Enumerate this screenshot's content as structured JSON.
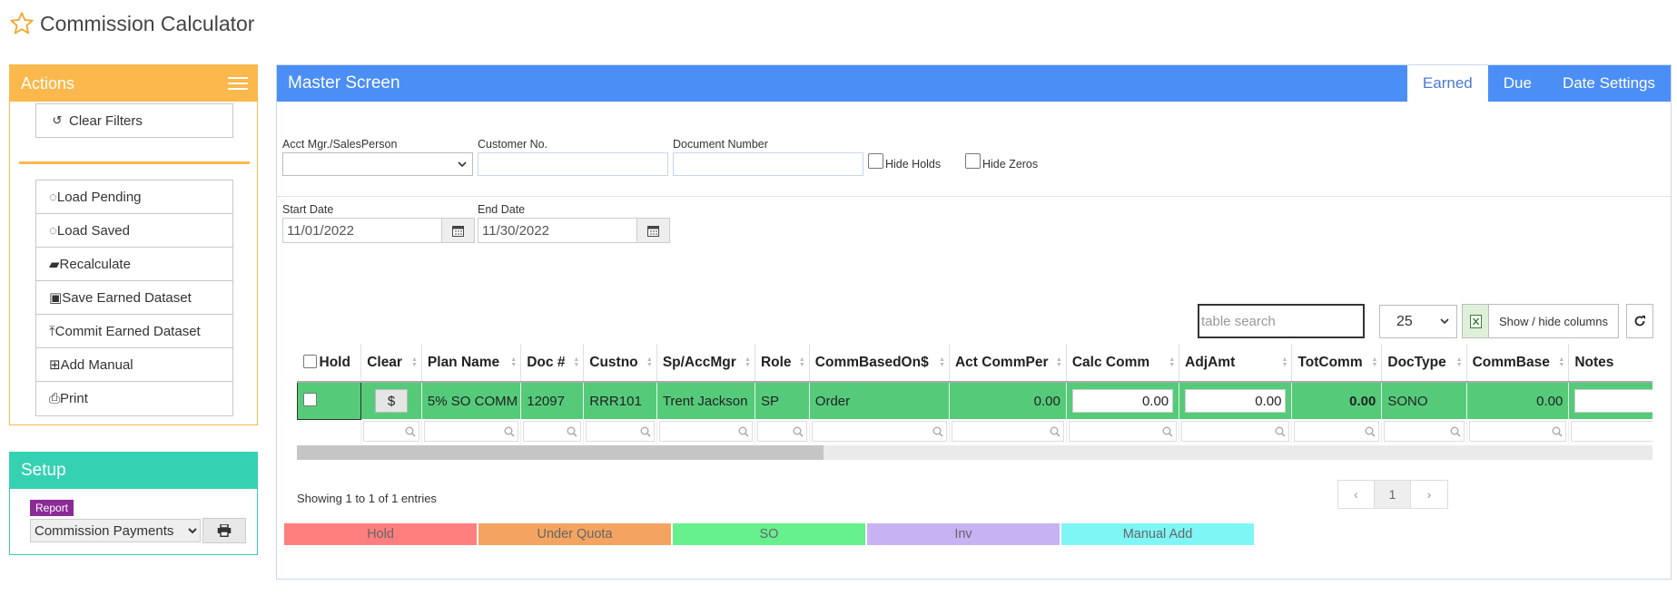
{
  "app": {
    "title": "Commission Calculator"
  },
  "actions": {
    "title": "Actions",
    "clear_filters": "Clear Filters",
    "items": [
      {
        "label": "Load Pending",
        "icon": "spinner-icon"
      },
      {
        "label": "Load Saved",
        "icon": "spinner-icon"
      },
      {
        "label": "Recalculate",
        "icon": "book-icon"
      },
      {
        "label": "Save Earned Dataset",
        "icon": "save-icon"
      },
      {
        "label": "Commit Earned Dataset",
        "icon": "upload-icon"
      },
      {
        "label": "Add Manual",
        "icon": "plus-square-icon"
      },
      {
        "label": "Print",
        "icon": "print-icon"
      }
    ]
  },
  "setup": {
    "title": "Setup",
    "badge": "Report",
    "report_value": "Commission Payments"
  },
  "master": {
    "title": "Master Screen",
    "tabs": [
      "Earned",
      "Due",
      "Date Settings"
    ],
    "active_tab": "Earned"
  },
  "filters": {
    "acct_mgr_label": "Acct Mgr./SalesPerson",
    "customer_label": "Customer No.",
    "document_label": "Document Number",
    "hide_holds_label": "Hide Holds",
    "hide_zeros_label": "Hide Zeros",
    "start_date_label": "Start Date",
    "start_date": "11/01/2022",
    "end_date_label": "End Date",
    "end_date": "11/30/2022"
  },
  "table_tools": {
    "search_placeholder": "table search",
    "page_size": "25",
    "show_hide": "Show / hide columns"
  },
  "table": {
    "columns": [
      "Hold",
      "Clear",
      "Plan Name",
      "Doc #",
      "Custno",
      "Sp/AccMgr",
      "Role",
      "CommBasedOn$",
      "Act CommPer",
      "Calc Comm",
      "AdjAmt",
      "TotComm",
      "DocType",
      "CommBase",
      "Notes"
    ],
    "row": {
      "clear": "$",
      "plan_name": "5% SO COMM",
      "doc": "12097",
      "custno": "RRR101",
      "sp": "Trent Jackson",
      "role": "SP",
      "comm_based_on": "Order",
      "act_comm_per": "0.00",
      "calc_comm": "0.00",
      "adj_amt": "0.00",
      "tot_comm": "0.00",
      "doc_type": "SONO",
      "comm_base": "0.00"
    }
  },
  "footer": {
    "showing": "Showing 1 to 1 of 1 entries",
    "pager": {
      "prev": "‹",
      "page": "1",
      "next": "›"
    }
  },
  "legend": [
    {
      "label": "Hold",
      "color": "#ff7f7f"
    },
    {
      "label": "Under Quota",
      "color": "#f4a460"
    },
    {
      "label": "SO",
      "color": "#66f08e"
    },
    {
      "label": "Inv",
      "color": "#c7b3f4"
    },
    {
      "label": "Manual Add",
      "color": "#7ff6f6"
    }
  ],
  "colors": {
    "actions": "#fbb84c",
    "setup": "#35d1b3",
    "master": "#4b8ef5",
    "row_green": "#55cb7a"
  }
}
